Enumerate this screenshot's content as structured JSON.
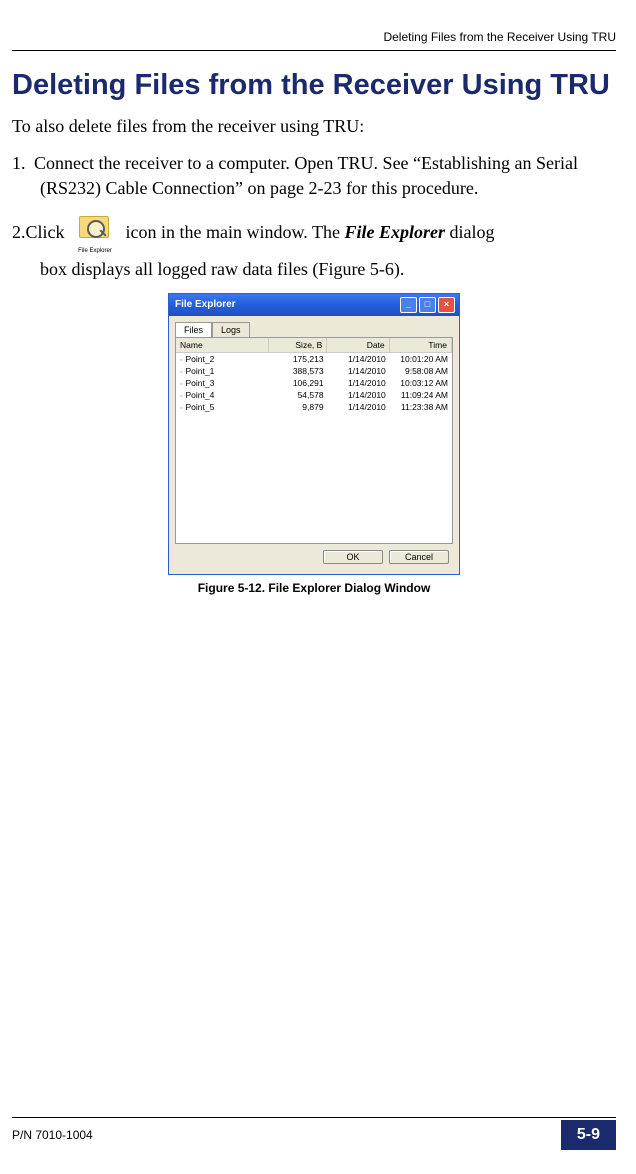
{
  "running_header": "Deleting Files from the Receiver Using TRU",
  "title": "Deleting Files from the Receiver Using TRU",
  "intro": "To also delete files from the receiver using TRU:",
  "step1_num": "1.",
  "step1_text": "Connect the receiver to a computer. Open TRU. See “Establishing an Serial (RS232) Cable Connection” on page 2-23 for this procedure.",
  "step2_num": "2.",
  "step2_a": "Click",
  "step2_b": "icon in the main window. The ",
  "step2_bold": "File Explorer",
  "step2_c": " dialog",
  "step2_line2": "box displays all logged raw data files (Figure 5-6).",
  "file_explorer_icon_label": "File Explorer",
  "dialog": {
    "title": "File Explorer",
    "tabs": {
      "t1": "Files",
      "t2": "Logs"
    },
    "columns": {
      "name": "Name",
      "size": "Size, B",
      "date": "Date",
      "time": "Time"
    },
    "rows": [
      {
        "name": "Point_2",
        "size": "175,213",
        "date": "1/14/2010",
        "time": "10:01:20 AM"
      },
      {
        "name": "Point_1",
        "size": "388,573",
        "date": "1/14/2010",
        "time": "9:58:08 AM"
      },
      {
        "name": "Point_3",
        "size": "106,291",
        "date": "1/14/2010",
        "time": "10:03:12 AM"
      },
      {
        "name": "Point_4",
        "size": "54,578",
        "date": "1/14/2010",
        "time": "11:09:24 AM"
      },
      {
        "name": "Point_5",
        "size": "9,879",
        "date": "1/14/2010",
        "time": "11:23:38 AM"
      }
    ],
    "ok": "OK",
    "cancel": "Cancel"
  },
  "figure_caption": "Figure 5-12. File Explorer Dialog Window",
  "footer": {
    "pn": "P/N 7010-1004",
    "page": "5-9"
  }
}
